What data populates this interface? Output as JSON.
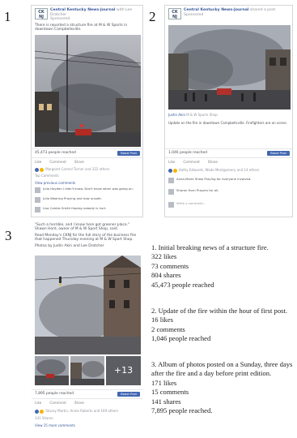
{
  "panels": [
    {
      "number": "1",
      "logo": "CK NJ",
      "page_name": "Central Kentucky News-Journal",
      "with_text": "with Lee Dratcher",
      "meta": "Sponsored",
      "post_text": "There is reported a structure fire at M & W Sports in downtown Campbellsville.",
      "reached": "45,473 people reached",
      "boost": "Boost Post",
      "actions": [
        "Like",
        "Comment",
        "Share"
      ],
      "reactions": "Margaret Carmel Turner and 322 others",
      "top_comments": "Top Comments",
      "view_previous": "View previous comments",
      "comments": [
        "Julia Hayden I didn't know. Don't know when was going on.",
        "Julia Wearing Praying and how unsafe.",
        "Lisa Combs Smith Hoping nobody is hurt."
      ]
    },
    {
      "number": "2",
      "logo": "CK NJ",
      "page_name": "Central Kentucky News-Journal",
      "with_text": "shared a post",
      "meta": "Sponsored",
      "share_name": "Justin Akin",
      "share_meta": "M & W Sports Shop",
      "share_text": "Update on the fire in downtown Campbellsville. Firefighters are on scene.",
      "reached": "1,046 people reached",
      "boost": "Boost Post",
      "actions": [
        "Like",
        "Comment",
        "Share"
      ],
      "reactions": "Kathy Edwards, Wade Montgomery and 14 others",
      "comments": [
        "Anna-Marie Shaw Praying for everyone involved.",
        "Sharon Horn Prayers for all.",
        "Write a comment..."
      ]
    },
    {
      "number": "3",
      "post_text_1": "\"Such a horrible, and I know here got greener place.\" Shawn Hord, owner of M & W Sport Shop, said.",
      "post_text_2": "Read Monday's CKNJ for the full story of the business fire that happened Thursday evening at M & W Sport Shop.",
      "post_text_3": "Photos by Justin Akin and Lee Dratcher",
      "more_photos": "+13",
      "reached": "7,895 people reached",
      "boost": "Boost Post",
      "actions": [
        "Like",
        "Comment",
        "Share"
      ],
      "reactions": "Stacey Martin, Annie Roberts and 169 others",
      "shares": "141 Shares",
      "view_comments": "View 15 more comments"
    }
  ],
  "captions": [
    {
      "title": "1. Initial breaking news of a structure fire.",
      "lines": [
        "322 likes",
        "73 comments",
        "804 shares",
        "45,473 people reached"
      ]
    },
    {
      "title": "2. Update of the fire within the hour of first post.",
      "lines": [
        "16 likes",
        "2 comments",
        "1,046 people reached"
      ]
    },
    {
      "title": "3. Album of photos posted on a Sunday, three days after the fire and a day before print edition.",
      "lines": [
        "171 likes",
        "15 comments",
        "141 shares",
        "7,895 people reached."
      ]
    }
  ],
  "colors": {
    "link": "#365899",
    "boost_button": "#4267b2",
    "border": "#d4d6da"
  }
}
